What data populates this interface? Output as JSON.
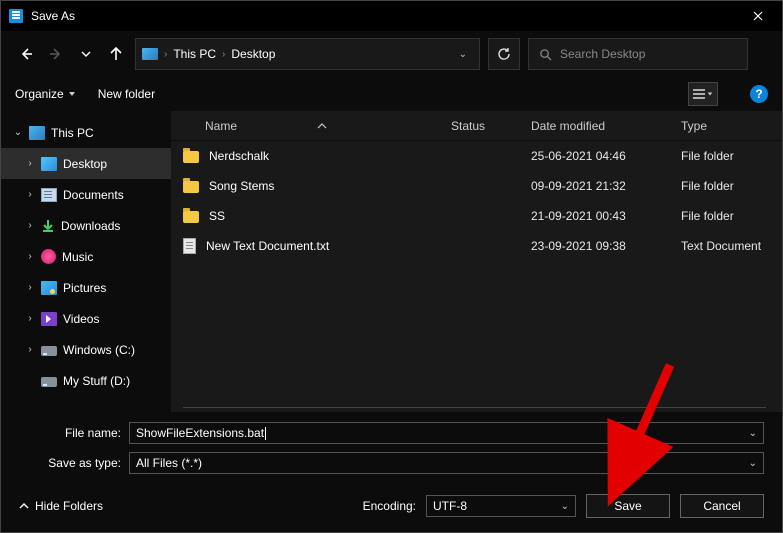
{
  "title": "Save As",
  "breadcrumb": {
    "root": "This PC",
    "current": "Desktop"
  },
  "search_placeholder": "Search Desktop",
  "toolbar": {
    "organize": "Organize",
    "new_folder": "New folder"
  },
  "help": "?",
  "sidebar": {
    "root": "This PC",
    "items": [
      {
        "label": "Desktop"
      },
      {
        "label": "Documents"
      },
      {
        "label": "Downloads"
      },
      {
        "label": "Music"
      },
      {
        "label": "Pictures"
      },
      {
        "label": "Videos"
      },
      {
        "label": "Windows (C:)"
      },
      {
        "label": "My Stuff (D:)"
      }
    ]
  },
  "columns": {
    "name": "Name",
    "status": "Status",
    "date": "Date modified",
    "type": "Type"
  },
  "files": [
    {
      "name": "Nerdschalk",
      "date": "25-06-2021 04:46",
      "type": "File folder",
      "kind": "folder"
    },
    {
      "name": "Song Stems",
      "date": "09-09-2021 21:32",
      "type": "File folder",
      "kind": "folder"
    },
    {
      "name": "SS",
      "date": "21-09-2021 00:43",
      "type": "File folder",
      "kind": "folder"
    },
    {
      "name": "New Text Document.txt",
      "date": "23-09-2021 09:38",
      "type": "Text Document",
      "kind": "txt"
    }
  ],
  "form": {
    "filename_label": "File name:",
    "filename_value": "ShowFileExtensions.bat",
    "type_label": "Save as type:",
    "type_value": "All Files  (*.*)"
  },
  "footer": {
    "hide": "Hide Folders",
    "encoding_label": "Encoding:",
    "encoding_value": "UTF-8",
    "save": "Save",
    "cancel": "Cancel"
  }
}
